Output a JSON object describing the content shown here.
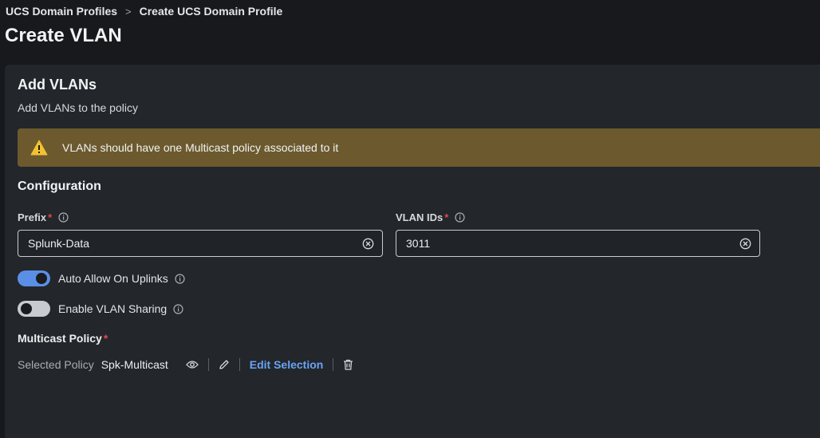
{
  "breadcrumb": {
    "items": [
      "UCS Domain Profiles",
      "Create UCS Domain Profile"
    ],
    "separator": ">"
  },
  "page": {
    "title": "Create VLAN"
  },
  "section": {
    "title": "Add VLANs",
    "subtitle": "Add VLANs to the policy"
  },
  "warning": {
    "text": "VLANs should have one Multicast policy associated to it",
    "icon": "warning-triangle-icon",
    "background": "#6c5a2e"
  },
  "configuration": {
    "title": "Configuration",
    "prefix": {
      "label": "Prefix",
      "required_mark": "*",
      "value": "Splunk-Data"
    },
    "vlan_ids": {
      "label": "VLAN IDs",
      "required_mark": "*",
      "value": "3011"
    },
    "auto_allow": {
      "label": "Auto Allow On Uplinks",
      "enabled": true
    },
    "vlan_sharing": {
      "label": "Enable VLAN Sharing",
      "enabled": false
    }
  },
  "multicast": {
    "label": "Multicast Policy",
    "required_mark": "*",
    "selected_label": "Selected Policy",
    "selected_value": "Spk-Multicast",
    "edit_label": "Edit Selection"
  },
  "colors": {
    "accent": "#5b8fe6",
    "link": "#6aa3f2",
    "required": "#e04848"
  }
}
